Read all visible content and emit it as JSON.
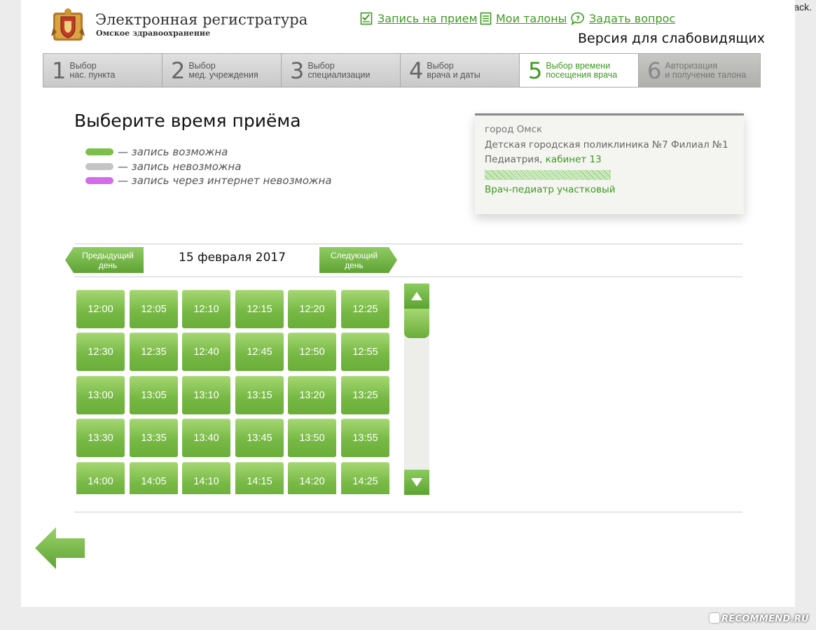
{
  "watermarks": {
    "top": ".paint.it.black.",
    "bottom": "RECOMMEND.RU"
  },
  "header": {
    "title": "Электронная регистратура",
    "subtitle": "Омское здравоохранение",
    "links": {
      "appointment": "Запись на прием",
      "tickets": "Мои талоны",
      "question": "Задать вопрос"
    },
    "accessibility": "Версия для слабовидящих"
  },
  "steps": [
    {
      "num": "1",
      "line1": "Выбор",
      "line2": "нас. пункта",
      "state": "done"
    },
    {
      "num": "2",
      "line1": "Выбор",
      "line2": "мед. учреждения",
      "state": "done"
    },
    {
      "num": "3",
      "line1": "Выбор",
      "line2": "специализации",
      "state": "done"
    },
    {
      "num": "4",
      "line1": "Выбор",
      "line2": "врача и даты",
      "state": "done"
    },
    {
      "num": "5",
      "line1": "Выбор времени",
      "line2": "посещения врача",
      "state": "active"
    },
    {
      "num": "6",
      "line1": "Авторизация",
      "line2": "и получение талона",
      "state": "disabled"
    }
  ],
  "main": {
    "title": "Выберите время приёма",
    "legend": [
      {
        "text": "— запись возможна",
        "color": "#7cc04b"
      },
      {
        "text": "— запись невозможна",
        "color": "#c4c4c4"
      },
      {
        "text": "— запись через интернет невозможна",
        "color": "#d46be8"
      }
    ]
  },
  "info": {
    "city": "город Омск",
    "clinic": "Детская городская поликлиника №7 Филиал №1",
    "specialty": "Педиатрия,",
    "cabinet": "кабинет 13",
    "position": "Врач-педиатр участковый"
  },
  "date_nav": {
    "prev_line1": "Предыдущий",
    "prev_line2": "день",
    "date": "15 февраля 2017",
    "next_line1": "Следующий",
    "next_line2": "день"
  },
  "slots": [
    [
      "12:00",
      "12:05",
      "12:10",
      "12:15",
      "12:20",
      "12:25"
    ],
    [
      "12:30",
      "12:35",
      "12:40",
      "12:45",
      "12:50",
      "12:55"
    ],
    [
      "13:00",
      "13:05",
      "13:10",
      "13:15",
      "13:20",
      "13:25"
    ],
    [
      "13:30",
      "13:35",
      "13:40",
      "13:45",
      "13:50",
      "13:55"
    ],
    [
      "14:00",
      "14:05",
      "14:10",
      "14:15",
      "14:20",
      "14:25"
    ]
  ],
  "colors": {
    "accent": "#3c9a1f",
    "slot_available": "#7cc04b"
  }
}
